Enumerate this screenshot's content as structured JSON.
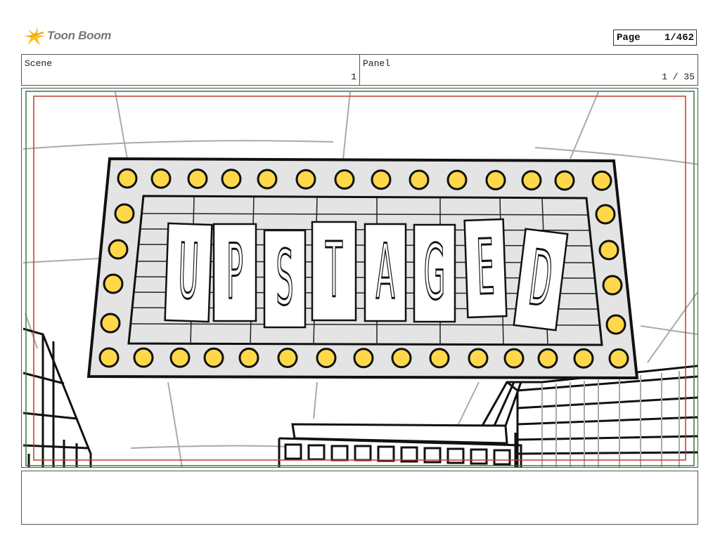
{
  "header": {
    "logo_text": "Toon Boom",
    "page_label": "Page",
    "page_value": "1/462"
  },
  "info": {
    "scene_label": "Scene",
    "scene_value": "1",
    "panel_label": "Panel",
    "panel_value": "1 / 35"
  },
  "panel": {
    "sign_letters": [
      "U",
      "P",
      "S",
      "T",
      "A",
      "G",
      "E",
      "D"
    ],
    "bulb_color": "#ffd84a",
    "sign_fill": "#e4e4e4",
    "safe_frame_color": "#c0392b",
    "action_frame_color": "#2e7d32"
  },
  "caption": {
    "text": ""
  }
}
